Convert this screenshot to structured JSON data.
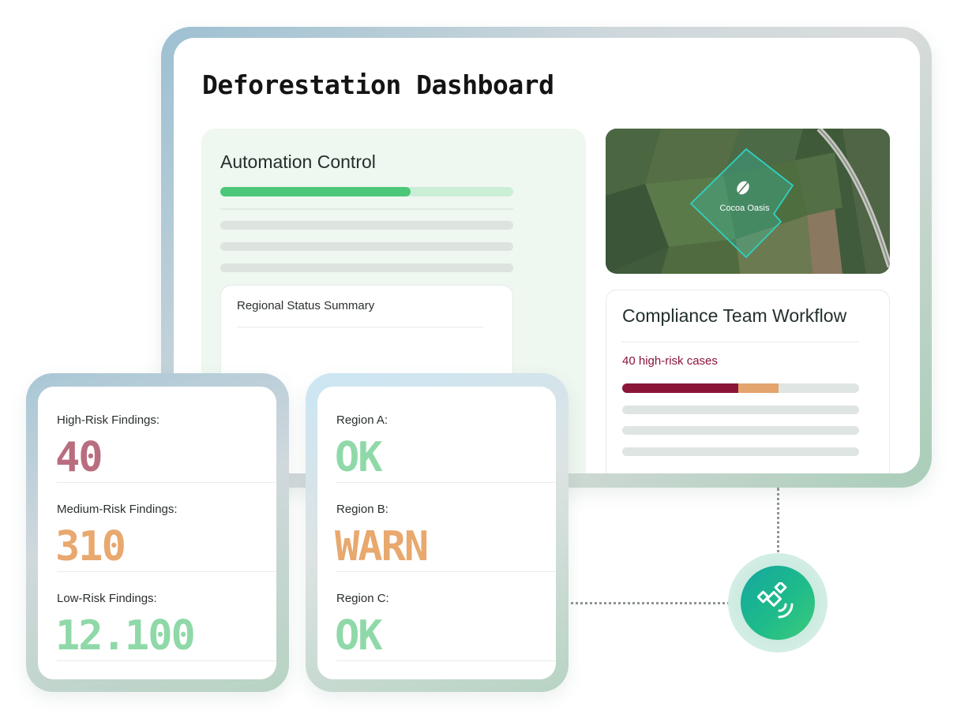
{
  "dashboard": {
    "title": "Deforestation Dashboard",
    "automation": {
      "title": "Automation Control",
      "progress": 0.65
    },
    "regional_summary": {
      "title": "Regional Status Summary"
    },
    "map": {
      "plot_label": "Cocoa Oasis",
      "plot_icon": "leaf-icon"
    },
    "compliance": {
      "title": "Compliance Team Workflow",
      "cases_label": "40 high-risk cases",
      "bar": {
        "high": 0.49,
        "medium": 0.17
      }
    }
  },
  "findings": [
    {
      "label": "High-Risk Findings:",
      "value": "40",
      "color": "#b96e7f"
    },
    {
      "label": "Medium-Risk Findings:",
      "value": "310",
      "color": "#e8a86e"
    },
    {
      "label": "Low-Risk Findings:",
      "value": "12.100",
      "color": "#8fd9a8"
    }
  ],
  "regions": [
    {
      "label": "Region A:",
      "status": "OK",
      "color": "#8fd9a8"
    },
    {
      "label": "Region B:",
      "status": "WARN",
      "color": "#e8a86e"
    },
    {
      "label": "Region C:",
      "status": "OK",
      "color": "#8fd9a8"
    }
  ],
  "satellite": {
    "icon": "satellite-icon"
  },
  "colors": {
    "accent_green": "#4cc779",
    "progress_track": "#cbeed7",
    "high_risk": "#8a1538",
    "medium_risk": "#e4a46e",
    "plot_outline": "#2fd1c0"
  }
}
